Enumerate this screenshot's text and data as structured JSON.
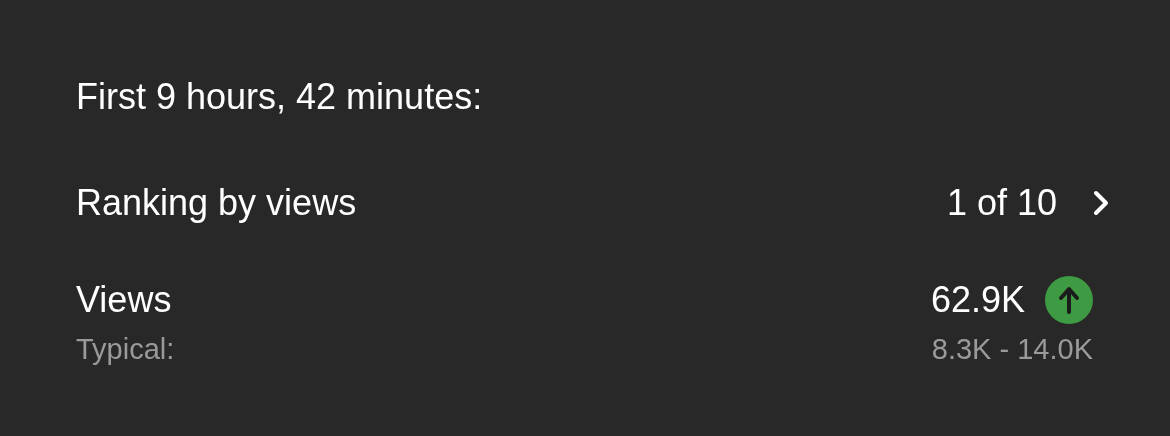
{
  "header": "First 9 hours, 42 minutes:",
  "ranking": {
    "label": "Ranking by views",
    "value": "1 of 10"
  },
  "views": {
    "label": "Views",
    "value": "62.9K",
    "trend": {
      "kind": "up"
    },
    "typical_label": "Typical:",
    "typical_range": "8.3K - 14.0K"
  }
}
